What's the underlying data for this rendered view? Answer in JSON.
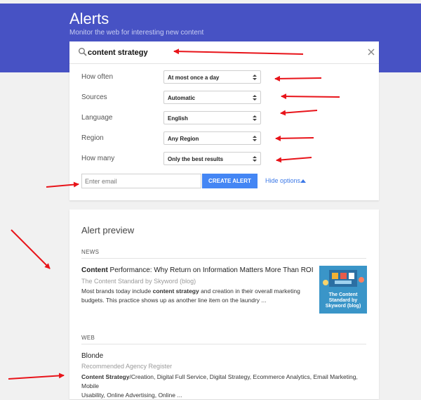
{
  "header": {
    "title": "Alerts",
    "subtitle": "Monitor the web for interesting new content"
  },
  "search": {
    "value": "content strategy"
  },
  "options": [
    {
      "label": "How often",
      "value": "At most once a day"
    },
    {
      "label": "Sources",
      "value": "Automatic"
    },
    {
      "label": "Language",
      "value": "English"
    },
    {
      "label": "Region",
      "value": "Any Region"
    },
    {
      "label": "How many",
      "value": "Only the best results"
    }
  ],
  "create": {
    "email_placeholder": "Enter email",
    "button_label": "CREATE ALERT",
    "hide_options_label": "Hide options"
  },
  "preview": {
    "title": "Alert preview",
    "news_label": "NEWS",
    "news_item": {
      "headline_bold": "Content",
      "headline_rest": " Performance: Why Return on Information Matters More Than ROI",
      "source": "The Content Standard by Skyword (blog)",
      "snippet_1a": "Most brands today include ",
      "snippet_1b": "content strategy",
      "snippet_1c": " and creation in their overall marketing",
      "snippet_2": "budgets. This practice shows up as another line item on the laundry ...",
      "thumb_text": "The Content Standard by Skyword (blog)"
    },
    "web_label": "WEB",
    "web_item": {
      "headline": "Blonde",
      "source": "Recommended Agency Register",
      "snippet_bold": "Content Strategy",
      "snippet_rest": "/Creation, Digital Full Service, Digital Strategy, Ecommerce Analytics, Email Marketing, Mobile",
      "snippet_2": "Usability, Online Advertising, Online ..."
    }
  },
  "colors": {
    "header_bg": "#4752c4",
    "button_bg": "#4486f4",
    "link": "#3b78e7",
    "annotation_arrow": "#e8141a"
  }
}
